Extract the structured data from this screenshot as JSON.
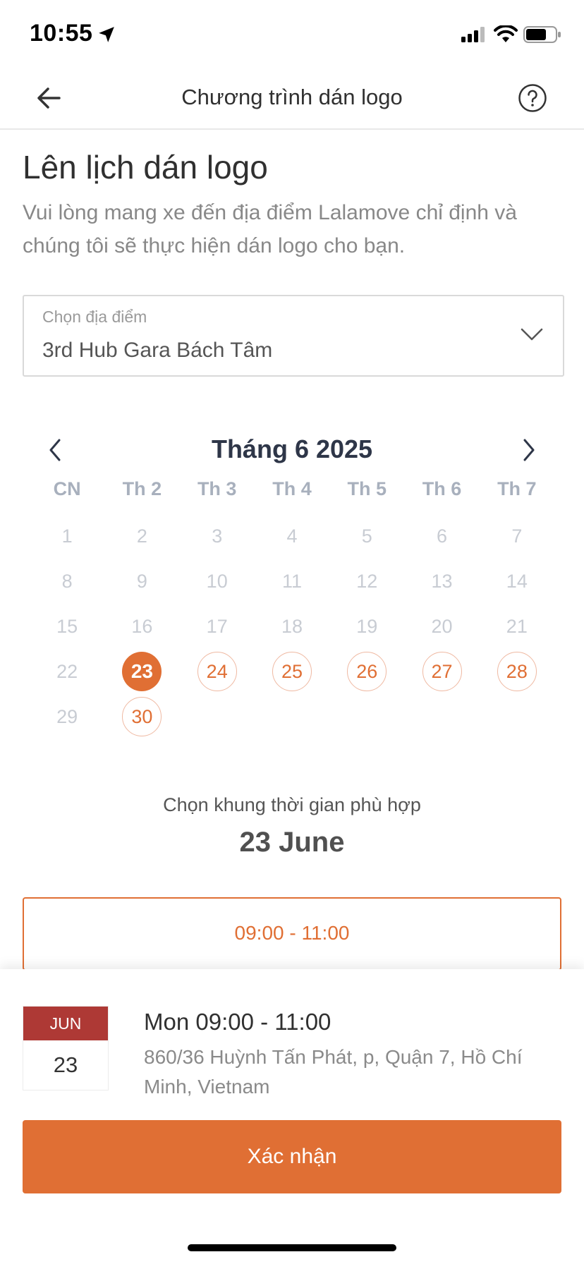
{
  "status_bar": {
    "time": "10:55"
  },
  "header": {
    "title": "Chương trình dán logo"
  },
  "intro": {
    "title": "Lên lịch dán logo",
    "description": "Vui lòng mang xe đến địa điểm Lalamove chỉ định và chúng tôi sẽ thực hiện dán logo cho bạn."
  },
  "location": {
    "label": "Chọn địa điểm",
    "value": "3rd Hub Gara Bách Tâm"
  },
  "calendar": {
    "month_label": "Tháng 6 2025",
    "weekdays": [
      "CN",
      "Th 2",
      "Th 3",
      "Th 4",
      "Th 5",
      "Th 6",
      "Th 7"
    ],
    "days": [
      {
        "d": "1",
        "state": "disabled"
      },
      {
        "d": "2",
        "state": "disabled"
      },
      {
        "d": "3",
        "state": "disabled"
      },
      {
        "d": "4",
        "state": "disabled"
      },
      {
        "d": "5",
        "state": "disabled"
      },
      {
        "d": "6",
        "state": "disabled"
      },
      {
        "d": "7",
        "state": "disabled"
      },
      {
        "d": "8",
        "state": "disabled"
      },
      {
        "d": "9",
        "state": "disabled"
      },
      {
        "d": "10",
        "state": "disabled"
      },
      {
        "d": "11",
        "state": "disabled"
      },
      {
        "d": "12",
        "state": "disabled"
      },
      {
        "d": "13",
        "state": "disabled"
      },
      {
        "d": "14",
        "state": "disabled"
      },
      {
        "d": "15",
        "state": "disabled"
      },
      {
        "d": "16",
        "state": "disabled"
      },
      {
        "d": "17",
        "state": "disabled"
      },
      {
        "d": "18",
        "state": "disabled"
      },
      {
        "d": "19",
        "state": "disabled"
      },
      {
        "d": "20",
        "state": "disabled"
      },
      {
        "d": "21",
        "state": "disabled"
      },
      {
        "d": "22",
        "state": "disabled"
      },
      {
        "d": "23",
        "state": "selected"
      },
      {
        "d": "24",
        "state": "available"
      },
      {
        "d": "25",
        "state": "available"
      },
      {
        "d": "26",
        "state": "available"
      },
      {
        "d": "27",
        "state": "available"
      },
      {
        "d": "28",
        "state": "available"
      },
      {
        "d": "29",
        "state": "disabled"
      },
      {
        "d": "30",
        "state": "available"
      }
    ]
  },
  "slots": {
    "caption": "Chọn khung thời gian phù hợp",
    "selected_date": "23 June",
    "options": [
      "09:00 - 11:00"
    ]
  },
  "summary": {
    "month": "JUN",
    "day": "23",
    "title": "Mon 09:00 - 11:00",
    "address": "860/36 Huỳnh Tấn Phát, p, Quận 7, Hồ Chí Minh, Vietnam"
  },
  "confirm_label": "Xác nhận",
  "colors": {
    "accent": "#e06f34",
    "date_card_header": "#ae3935",
    "disabled_day": "#c8ccd3"
  }
}
